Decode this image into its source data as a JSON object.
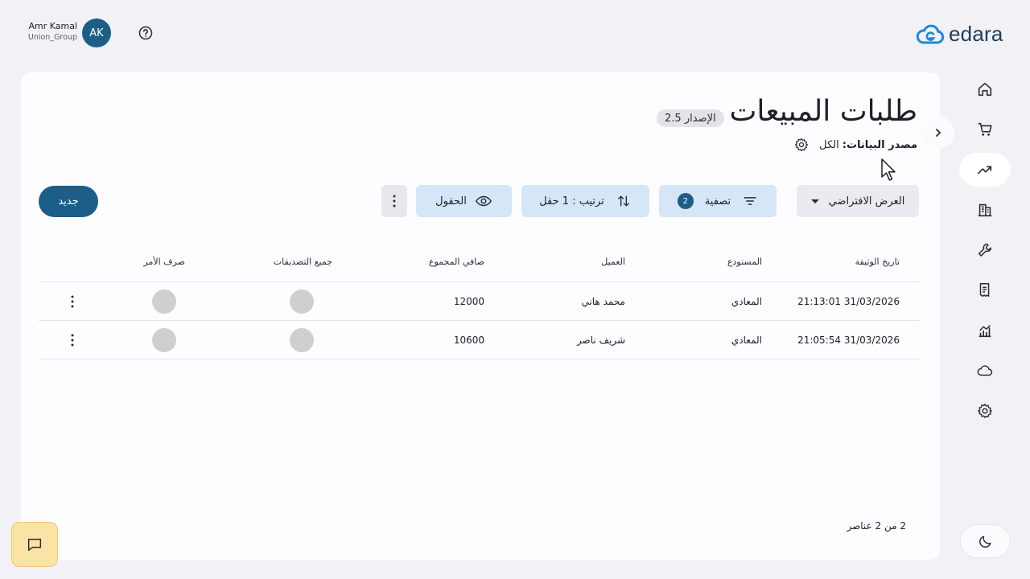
{
  "user": {
    "name": "Amr Kamal",
    "group": "Union_Group",
    "initials": "AK"
  },
  "logo": {
    "text": "edara"
  },
  "page": {
    "title": "طلبات المبيعات",
    "version": "الإصدار 2.5",
    "data_source_label": "مصدر البيانات:",
    "data_source_value": "الكل"
  },
  "toolbar": {
    "view_label": "العرض الافتراضي",
    "filter_label": "تصفية",
    "filter_count": "2",
    "sort_label": "ترتيب : 1 حقل",
    "fields_label": "الحقول",
    "new_label": "جديد"
  },
  "table": {
    "columns": [
      "تاريخ الوثيقة",
      "المستودع",
      "العميل",
      "صافي المجموع",
      "جميع التصديقات",
      "صرف الأمر"
    ],
    "rows": [
      {
        "date": "31/03/2026 21:13:01",
        "warehouse": "المعادي",
        "client": "محمد هاني",
        "total": "12000"
      },
      {
        "date": "31/03/2026 21:05:54",
        "warehouse": "المعادي",
        "client": "شريف ناصر",
        "total": "10600"
      }
    ]
  },
  "pagination": {
    "text": "2 من 2 عناصر"
  },
  "nav": {
    "items": [
      "home-icon",
      "cart-icon",
      "trending-up-icon",
      "building-icon",
      "wrench-icon",
      "receipt-icon",
      "analytics-icon",
      "cloud-icon",
      "settings-icon"
    ],
    "active": "trending-up-icon"
  },
  "colors": {
    "primary": "#1c5e88",
    "accent_light": "#d4e6f7",
    "chat": "#fbe3a6"
  }
}
